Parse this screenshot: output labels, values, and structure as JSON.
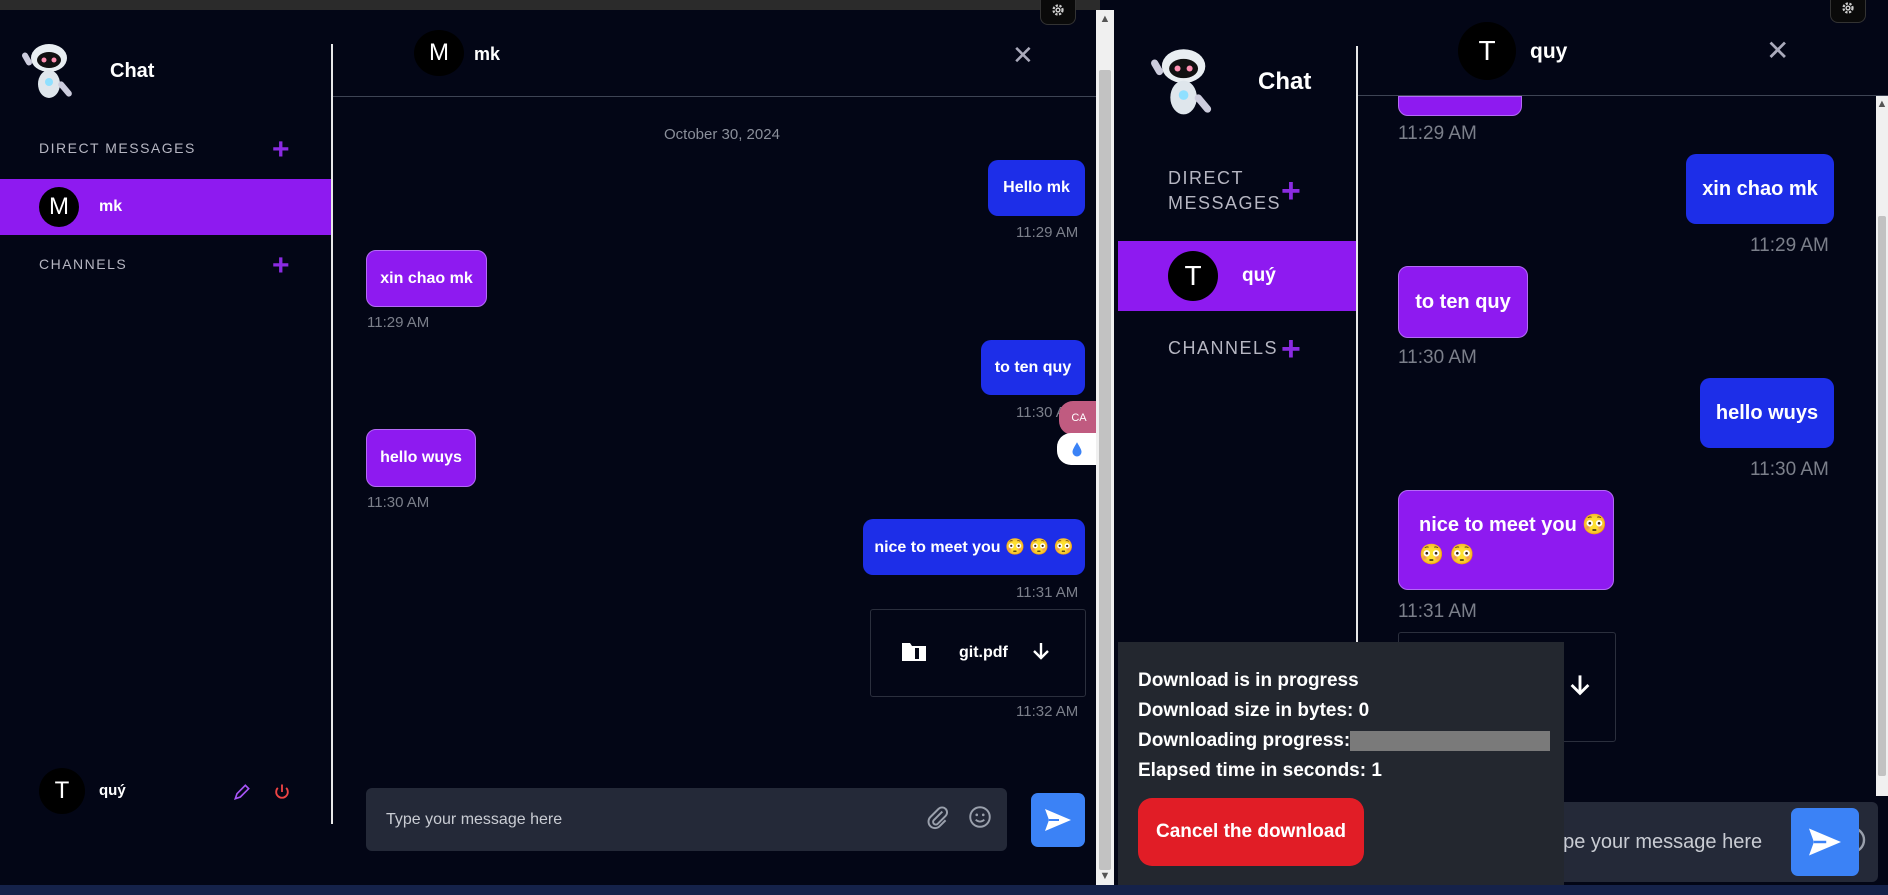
{
  "colors": {
    "accent": "#8e1af0",
    "mine_bubble": "#1d2ee8",
    "send": "#3b82f6",
    "cancel": "#e11d26",
    "background": "#030616"
  },
  "left": {
    "sidebar": {
      "title": "Chat",
      "direct_messages_label": "DIRECT MESSAGES",
      "channels_label": "CHANNELS",
      "dm_items": [
        {
          "initial": "M",
          "name": "mk"
        }
      ],
      "user": {
        "initial": "T",
        "name": "quý"
      }
    },
    "header": {
      "initial": "M",
      "name": "mk"
    },
    "date_divider": "October 30, 2024",
    "messages": [
      {
        "from": "me",
        "text": "Hello mk",
        "time": "11:29 AM"
      },
      {
        "from": "them",
        "text": "xin chao mk",
        "time": "11:29 AM"
      },
      {
        "from": "me",
        "text": "to ten quy",
        "time": "11:30 AM"
      },
      {
        "from": "them",
        "text": "hello wuys",
        "time": "11:30 AM"
      },
      {
        "from": "me",
        "text": "nice to meet you 😳 😳 😳",
        "time": "11:31 AM"
      },
      {
        "from": "me",
        "file": "git.pdf",
        "time": "11:32 AM"
      }
    ],
    "input_placeholder": "Type your message here"
  },
  "right": {
    "sidebar": {
      "title": "Chat",
      "direct_messages_label": "DIRECT MESSAGES",
      "channels_label": "CHANNELS",
      "dm_items": [
        {
          "initial": "T",
          "name": "quý"
        }
      ]
    },
    "header": {
      "initial": "T",
      "name": "quy"
    },
    "messages": [
      {
        "from": "them",
        "text": "",
        "time": "11:29 AM"
      },
      {
        "from": "me",
        "text": "xin chao mk",
        "time": "11:29 AM"
      },
      {
        "from": "them",
        "text": "to ten quy",
        "time": "11:30 AM"
      },
      {
        "from": "me",
        "text": "hello wuys",
        "time": "11:30 AM"
      },
      {
        "from": "them",
        "text": "nice to meet you 😳 😳 😳",
        "time": "11:31 AM"
      }
    ],
    "input_placeholder": "Type your message here",
    "download": {
      "status": "Download is in progress",
      "size": "Download size in bytes: 0",
      "progress_label": "Downloading progress:",
      "progress": 0,
      "elapsed": "Elapsed time in seconds: 1",
      "cancel_label": "Cancel the download"
    }
  }
}
